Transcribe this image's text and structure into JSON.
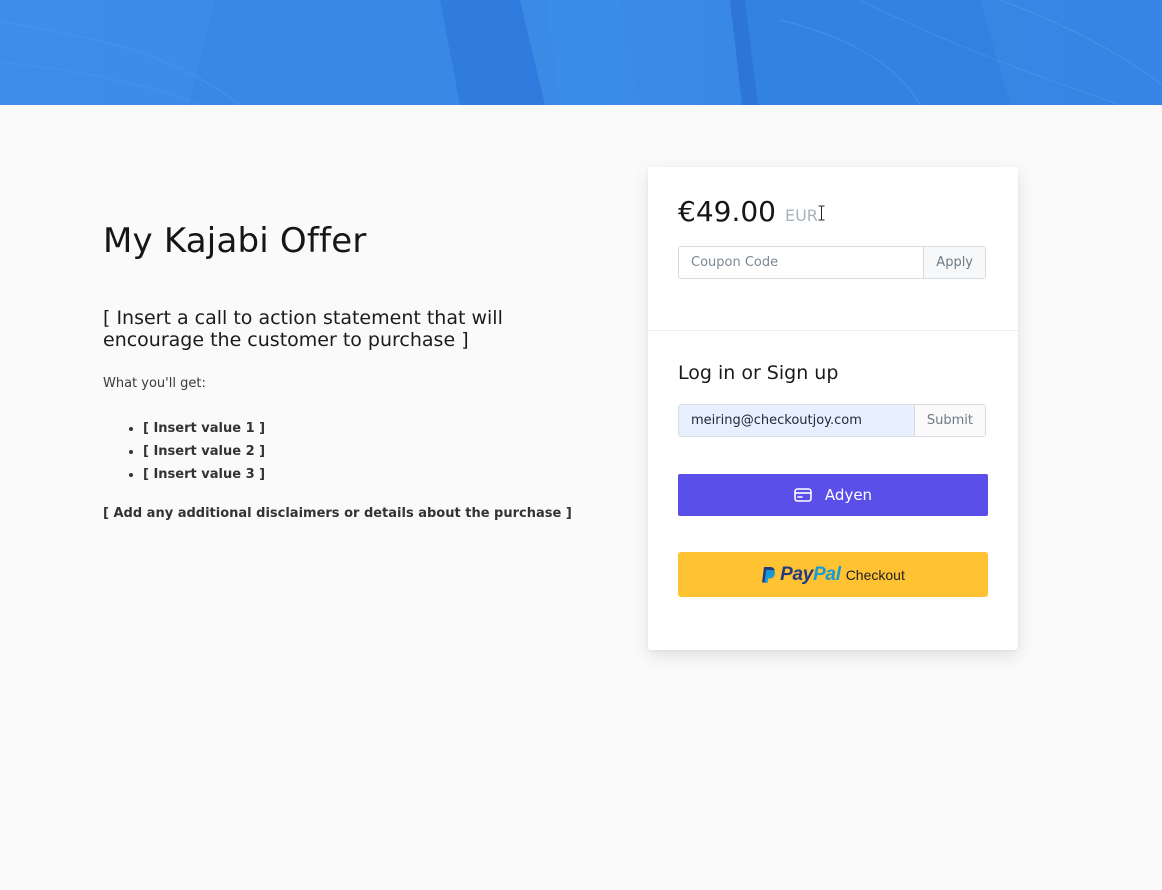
{
  "offer": {
    "title": "My Kajabi Offer",
    "cta": "[ Insert a call to action statement that will encourage the customer to purchase ]",
    "what_you_get": "What you'll get:",
    "benefits": [
      "[ Insert value 1 ]",
      "[ Insert value 2 ]",
      "[ Insert value 3 ]"
    ],
    "disclaimer": "[ Add any additional disclaimers or details about the purchase ]"
  },
  "checkout": {
    "price": "€49.00",
    "currency": "EUR",
    "coupon": {
      "placeholder": "Coupon Code",
      "value": "",
      "button_label": "Apply"
    },
    "login": {
      "heading": "Log in or Sign up",
      "email_value": "meiring@checkoutjoy.com",
      "button_label": "Submit"
    },
    "adyen": {
      "label": "Adyen",
      "icon": "credit-card-icon"
    },
    "paypal": {
      "logo_pay": "Pay",
      "logo_pal": "Pal",
      "label": "Checkout",
      "icon": "paypal-logo-icon"
    }
  },
  "colors": {
    "hero_blue": "#3b8ce8",
    "adyen_purple": "#5a4fe8",
    "paypal_yellow": "#ffc233",
    "paypal_navy": "#253b80",
    "paypal_light_blue": "#179bd7",
    "currency_gray": "#a8b4bd",
    "autofill_blue": "#e8f0fe"
  }
}
